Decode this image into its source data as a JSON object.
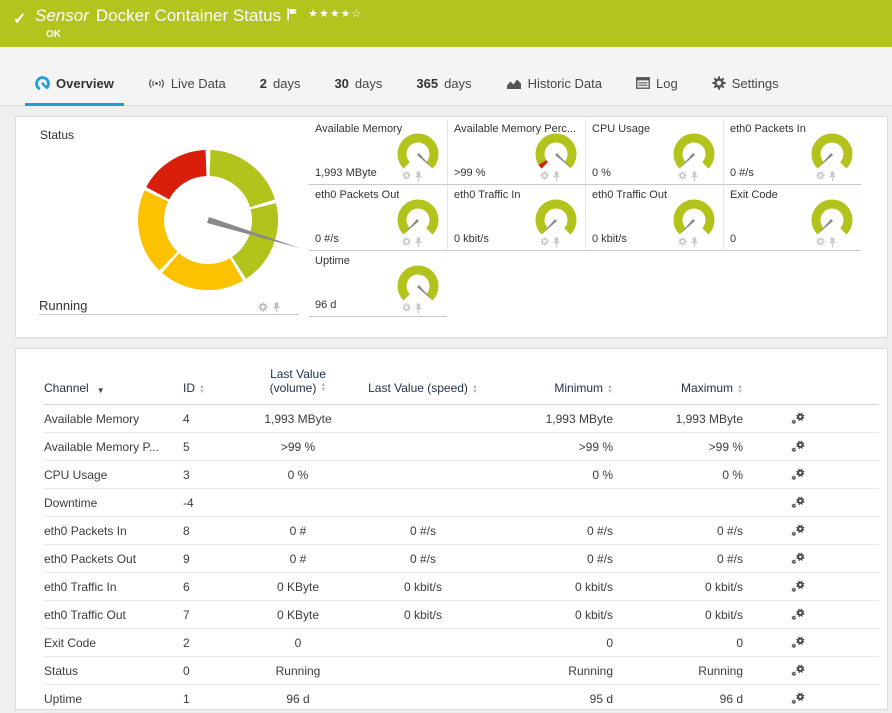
{
  "icons": {
    "check": "✓",
    "stars": "★★★★☆",
    "sort_asc": "▲",
    "sort_desc": "▼",
    "sort_active": "▼"
  },
  "colors": {
    "header_green": "#b4c41f",
    "gauge_green": "#b2c31c",
    "gauge_yellow": "#fcc200",
    "gauge_red": "#d91e09",
    "needle_gray": "#8a8a8a",
    "accent_blue": "#1b9fd6"
  },
  "header": {
    "type_label": "Sensor",
    "title": "Docker Container Status",
    "status": "OK",
    "priority_stars": "★★★★☆"
  },
  "tabs": {
    "items": [
      {
        "label": "Overview",
        "active": true
      },
      {
        "label": "Live Data"
      },
      {
        "num": "2",
        "label": "days"
      },
      {
        "num": "30",
        "label": "days"
      },
      {
        "num": "365",
        "label": "days"
      },
      {
        "label": "Historic Data"
      },
      {
        "label": "Log"
      },
      {
        "label": "Settings"
      }
    ]
  },
  "status_panel": {
    "main_gauge": {
      "label": "Status",
      "value": "Running",
      "needle_deg": 107,
      "segments": [
        {
          "from": 2,
          "to": 73,
          "color": "#b2c31c"
        },
        {
          "from": 76,
          "to": 147,
          "color": "#b2c31c"
        },
        {
          "from": 150,
          "to": 221,
          "color": "#fcc200"
        },
        {
          "from": 224,
          "to": 295,
          "color": "#fcc200"
        },
        {
          "from": 298,
          "to": 358,
          "color": "#d91e09"
        }
      ]
    },
    "gauges": [
      {
        "label": "Available Memory",
        "value": "1,993 MByte",
        "needle_deg": 135
      },
      {
        "label": "Available Memory Perc...",
        "value": ">99 %",
        "needle_deg": 133,
        "red_segment": [
          -135,
          -122
        ]
      },
      {
        "label": "CPU Usage",
        "value": "0 %",
        "needle_deg": -135
      },
      {
        "label": "eth0 Packets In",
        "value": "0 #/s",
        "needle_deg": -135
      },
      {
        "label": "eth0 Packets Out",
        "value": "0 #/s",
        "needle_deg": -135
      },
      {
        "label": "eth0 Traffic In",
        "value": "0 kbit/s",
        "needle_deg": -135
      },
      {
        "label": "eth0 Traffic Out",
        "value": "0 kbit/s",
        "needle_deg": -135
      },
      {
        "label": "Exit Code",
        "value": "0",
        "needle_deg": -135
      },
      {
        "label": "Uptime",
        "value": "96 d",
        "needle_deg": 135
      }
    ]
  },
  "table": {
    "columns": [
      {
        "label": "Channel",
        "sorted": true
      },
      {
        "label": "ID"
      },
      {
        "label": "Last Value",
        "label2": "(volume)"
      },
      {
        "label": "Last Value (speed)"
      },
      {
        "label": "Minimum"
      },
      {
        "label": "Maximum"
      }
    ],
    "rows": [
      {
        "channel": "Available Memory",
        "id": "4",
        "volume": "1,993 MByte",
        "speed": "",
        "min": "1,993 MByte",
        "max": "1,993 MByte"
      },
      {
        "channel": "Available Memory P...",
        "id": "5",
        "volume": ">99 %",
        "speed": "",
        "min": ">99 %",
        "max": ">99 %"
      },
      {
        "channel": "CPU Usage",
        "id": "3",
        "volume": "0 %",
        "speed": "",
        "min": "0 %",
        "max": "0 %"
      },
      {
        "channel": "Downtime",
        "id": "-4",
        "volume": "",
        "speed": "",
        "min": "",
        "max": ""
      },
      {
        "channel": "eth0 Packets In",
        "id": "8",
        "volume": "0 #",
        "speed": "0 #/s",
        "min": "0 #/s",
        "max": "0 #/s"
      },
      {
        "channel": "eth0 Packets Out",
        "id": "9",
        "volume": "0 #",
        "speed": "0 #/s",
        "min": "0 #/s",
        "max": "0 #/s"
      },
      {
        "channel": "eth0 Traffic In",
        "id": "6",
        "volume": "0 KByte",
        "speed": "0 kbit/s",
        "min": "0 kbit/s",
        "max": "0 kbit/s"
      },
      {
        "channel": "eth0 Traffic Out",
        "id": "7",
        "volume": "0 KByte",
        "speed": "0 kbit/s",
        "min": "0 kbit/s",
        "max": "0 kbit/s"
      },
      {
        "channel": "Exit Code",
        "id": "2",
        "volume": "0",
        "speed": "",
        "min": "0",
        "max": "0"
      },
      {
        "channel": "Status",
        "id": "0",
        "volume": "Running",
        "speed": "",
        "min": "Running",
        "max": "Running"
      },
      {
        "channel": "Uptime",
        "id": "1",
        "volume": "96 d",
        "speed": "",
        "min": "95 d",
        "max": "96 d"
      }
    ]
  }
}
